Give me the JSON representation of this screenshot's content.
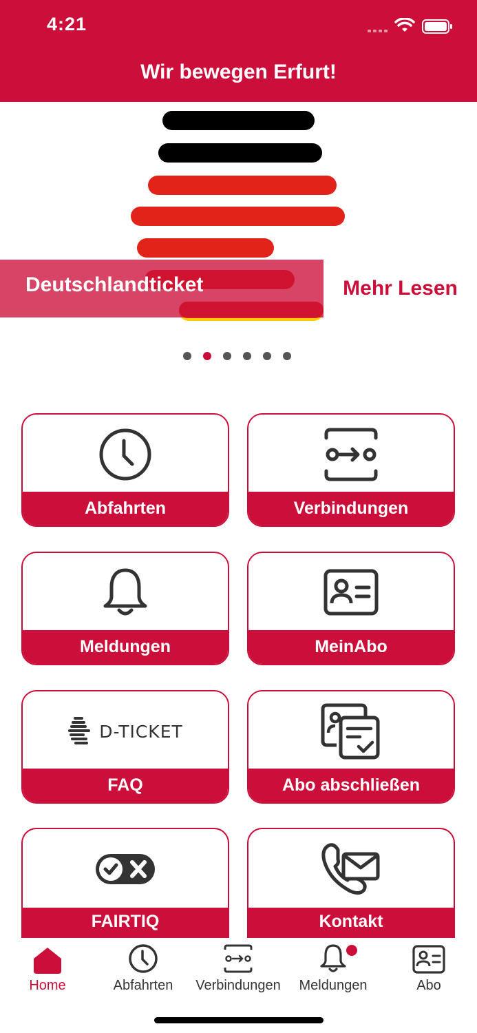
{
  "status_bar": {
    "time": "4:21"
  },
  "header": {
    "title": "Wir bewegen Erfurt!"
  },
  "carousel": {
    "banner_title": "Deutschlandticket",
    "more_label": "Mehr Lesen",
    "page_count": 6,
    "active_page": 2
  },
  "tiles": [
    {
      "label": "Abfahrten",
      "icon": "clock-icon"
    },
    {
      "label": "Verbindungen",
      "icon": "route-icon"
    },
    {
      "label": "Meldungen",
      "icon": "bell-icon"
    },
    {
      "label": "MeinAbo",
      "icon": "id-card-icon"
    },
    {
      "label": "FAQ",
      "icon": "d-ticket-logo",
      "logo_text": "D-TICKET"
    },
    {
      "label": "Abo abschließen",
      "icon": "documents-check-icon"
    },
    {
      "label": "FAIRTIQ",
      "icon": "check-cross-toggle-icon"
    },
    {
      "label": "Kontakt",
      "icon": "phone-mail-icon"
    }
  ],
  "tabbar": [
    {
      "label": "Home",
      "icon": "home-icon",
      "active": true
    },
    {
      "label": "Abfahrten",
      "icon": "clock-icon"
    },
    {
      "label": "Verbindungen",
      "icon": "route-icon"
    },
    {
      "label": "Meldungen",
      "icon": "bell-icon",
      "badge": true
    },
    {
      "label": "Abo",
      "icon": "id-card-icon"
    }
  ],
  "colors": {
    "brand": "#cc0f3a",
    "black": "#000000",
    "ticket_red": "#e2231a",
    "ticket_gold": "#ffcc00"
  }
}
